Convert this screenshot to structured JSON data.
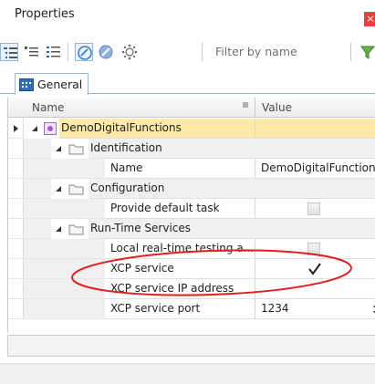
{
  "window": {
    "title": "Properties",
    "close_glyph": "×"
  },
  "toolbar": {
    "buttons": [
      "categorized-view-icon",
      "collapse-all-icon",
      "list-view-icon",
      "show-properties-icon",
      "show-events-icon",
      "show-all-icon"
    ],
    "filter_placeholder": "Filter by name",
    "filter_button_icon": "filter-icon"
  },
  "tabs": [
    {
      "label": "General",
      "icon": "general-tab-icon"
    }
  ],
  "grid": {
    "columns": {
      "name": "Name",
      "value": "Value"
    },
    "root": {
      "label": "DemoDigitalFunctions",
      "icon": "component-icon"
    },
    "groups": {
      "identification": "Identification",
      "configuration": "Configuration",
      "runtime": "Run-Time Services"
    },
    "properties": {
      "name": {
        "label": "Name",
        "value": "DemoDigitalFunctions"
      },
      "default_task": {
        "label": "Provide default task",
        "checked": false
      },
      "local_rt": {
        "label": "Local real-time testing a...",
        "checked": false
      },
      "xcp_service": {
        "label": "XCP service",
        "checked": true
      },
      "xcp_ip": {
        "label": "XCP service IP address",
        "value": ""
      },
      "xcp_port": {
        "label": "XCP service port",
        "value": "1234"
      }
    }
  },
  "colors": {
    "selected_root": "#fde9a8",
    "annotation": "#e02020",
    "tab_border": "#9fb7d2"
  }
}
